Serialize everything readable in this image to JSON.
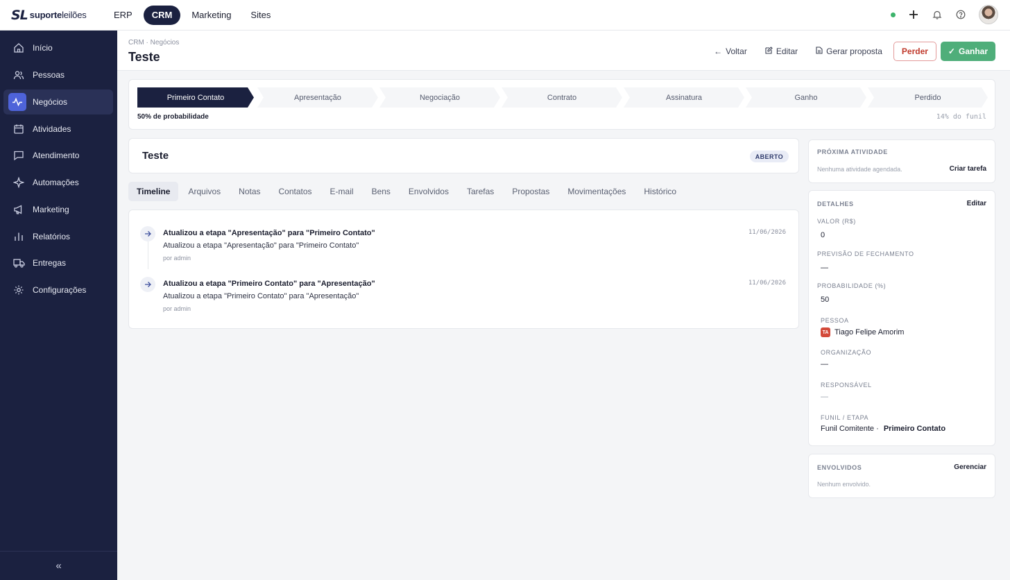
{
  "logo": {
    "mark": "SL",
    "text_bold": "suporte",
    "text_light": "leilões"
  },
  "topnav": [
    "ERP",
    "CRM",
    "Marketing",
    "Sites"
  ],
  "sidebar": {
    "items": [
      {
        "label": "Início",
        "icon": "home-icon"
      },
      {
        "label": "Pessoas",
        "icon": "users-icon"
      },
      {
        "label": "Negócios",
        "icon": "activity-icon"
      },
      {
        "label": "Atividades",
        "icon": "calendar-icon"
      },
      {
        "label": "Atendimento",
        "icon": "chat-icon"
      },
      {
        "label": "Automações",
        "icon": "sparkle-icon"
      },
      {
        "label": "Marketing",
        "icon": "megaphone-icon"
      },
      {
        "label": "Relatórios",
        "icon": "bar-chart-icon"
      },
      {
        "label": "Entregas",
        "icon": "truck-icon"
      },
      {
        "label": "Configurações",
        "icon": "gear-icon"
      }
    ],
    "collapse_glyph": "«"
  },
  "header": {
    "breadcrumb": "CRM · Negócios",
    "title": "Teste",
    "buttons": {
      "voltar": "Voltar",
      "editar": "Editar",
      "gerar": "Gerar proposta",
      "perder": "Perder",
      "ganhar": "Ganhar"
    }
  },
  "pipeline": {
    "stages": [
      "Primeiro Contato",
      "Apresentação",
      "Negociação",
      "Contrato",
      "Assinatura",
      "Ganho",
      "Perdido"
    ],
    "active_stage": "Primeiro Contato",
    "probability_text": "50% de probabilidade",
    "funnel_text": "14% do funil"
  },
  "deal": {
    "title": "Teste",
    "status": "ABERTO"
  },
  "tabs": [
    "Timeline",
    "Arquivos",
    "Notas",
    "Contatos",
    "E-mail",
    "Bens",
    "Envolvidos",
    "Tarefas",
    "Propostas",
    "Movimentações",
    "Histórico"
  ],
  "timeline": [
    {
      "title": "Atualizou a etapa \"Apresentação\" para \"Primeiro Contato\"",
      "desc": "Atualizou a etapa \"Apresentação\" para \"Primeiro Contato\"",
      "by": "por admin",
      "date": "11/06/2026"
    },
    {
      "title": "Atualizou a etapa \"Primeiro Contato\" para \"Apresentação\"",
      "desc": "Atualizou a etapa \"Primeiro Contato\" para \"Apresentação\"",
      "by": "por admin",
      "date": "11/06/2026"
    }
  ],
  "next_activity": {
    "label": "PRÓXIMA ATIVIDADE",
    "empty": "Nenhuma atividade agendada.",
    "action": "Criar tarefa"
  },
  "details": {
    "label": "DETALHES",
    "action": "Editar",
    "valor_label": "VALOR (R$)",
    "valor": "0",
    "previsao_label": "PREVISÃO DE FECHAMENTO",
    "previsao": "—",
    "prob_label": "PROBABILIDADE (%)",
    "prob": "50",
    "pessoa_label": "PESSOA",
    "pessoa_initials": "TA",
    "pessoa": "Tiago Felipe Amorim",
    "org_label": "ORGANIZAÇÃO",
    "org": "—",
    "resp_label": "RESPONSÁVEL",
    "resp": "—",
    "funil_label": "FUNIL / ETAPA",
    "funil": "Funil Comitente ·",
    "etapa": "Primeiro Contato"
  },
  "envolvidos": {
    "label": "ENVOLVIDOS",
    "action": "Gerenciar",
    "empty": "Nenhum envolvido."
  },
  "colors": {
    "navy": "#1b2140",
    "accent": "#4e63d9",
    "success": "#4fae7a",
    "danger": "#c0392b"
  }
}
